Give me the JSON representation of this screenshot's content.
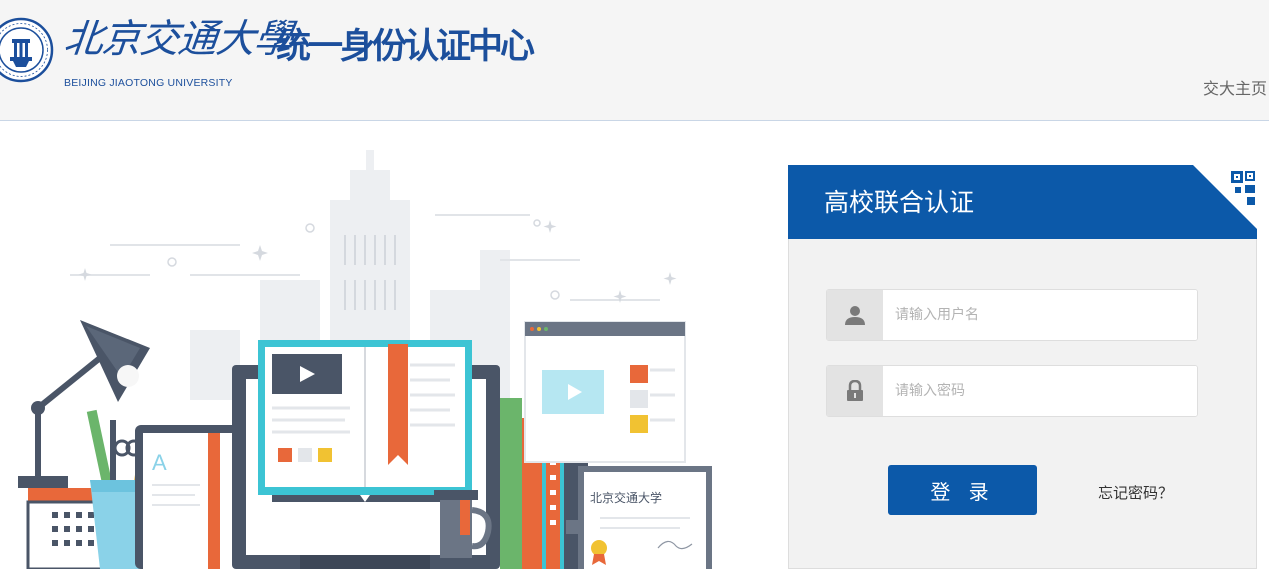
{
  "header": {
    "script_name": "北京交通大學",
    "en_name": "BEIJING JIAOTONG UNIVERSITY",
    "system_title": "统一身份认证中心",
    "home_link": "交大主页"
  },
  "illustration": {
    "certificate_text": "北京交通大学"
  },
  "login": {
    "title": "高校联合认证",
    "username_placeholder": "请输入用户名",
    "password_placeholder": "请输入密码",
    "submit_label": "登 录",
    "forgot_label": "忘记密码？"
  },
  "colors": {
    "brand_blue": "#0c59a9",
    "title_blue": "#1c4f9c",
    "orange": "#e8683a",
    "teal": "#3cc4d4"
  },
  "icons": [
    "university-emblem-icon",
    "qr-code-icon",
    "user-icon",
    "lock-icon",
    "play-icon"
  ]
}
